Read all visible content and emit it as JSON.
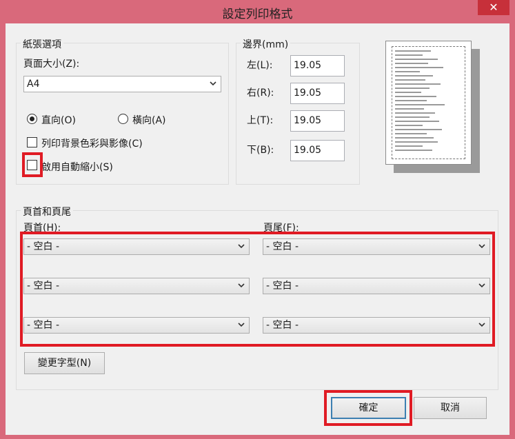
{
  "window": {
    "title": "設定列印格式",
    "close_glyph": "✕"
  },
  "paper": {
    "legend": "紙張選項",
    "size_label": "頁面大小(Z):",
    "size_value": "A4",
    "portrait_label": "直向(O)",
    "landscape_label": "橫向(A)",
    "print_bg_label": "列印背景色彩與影像(C)",
    "shrink_label": "啟用自動縮小(S)"
  },
  "margins": {
    "legend": "邊界(mm)",
    "left_label": "左(L):",
    "left_value": "19.05",
    "right_label": "右(R):",
    "right_value": "19.05",
    "top_label": "上(T):",
    "top_value": "19.05",
    "bottom_label": "下(B):",
    "bottom_value": "19.05"
  },
  "header_footer": {
    "legend": "頁首和頁尾",
    "header_label": "頁首(H):",
    "footer_label": "頁尾(F):",
    "header_values": [
      "- 空白 -",
      "- 空白 -",
      "- 空白 -"
    ],
    "footer_values": [
      "- 空白 -",
      "- 空白 -",
      "- 空白 -"
    ],
    "change_font_label": "變更字型(N)"
  },
  "buttons": {
    "ok_label": "確定",
    "cancel_label": "取消"
  }
}
